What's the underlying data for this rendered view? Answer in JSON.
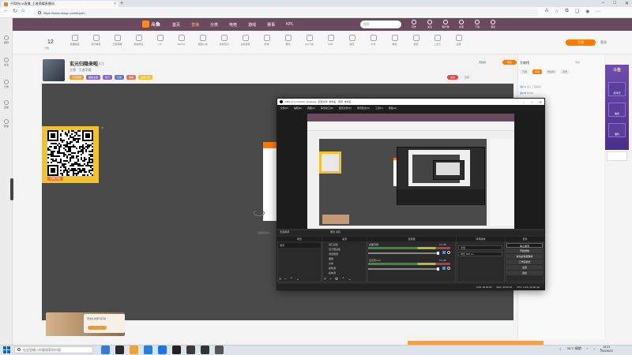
{
  "browser": {
    "tab_title": "不知所CA直播_王者荣耀直播间",
    "url": "https://www.douyu.com/topic/..."
  },
  "site": {
    "logo": "斗鱼",
    "nav": [
      "首页",
      "直播",
      "分类",
      "电竞",
      "游戏",
      "赛事",
      "KPL"
    ],
    "search_placeholder": "搜索",
    "header_icons": [
      "历史",
      "关注",
      "客户端",
      "充值",
      "下载",
      "消息"
    ],
    "category_count": "12",
    "category_count_label": "分类",
    "categories": [
      "英雄联盟",
      "和平精英",
      "王者荣耀",
      "绝地求生",
      "CS",
      "DOTA2",
      "穿越火线",
      "永劫无间",
      "主机游戏",
      "原神",
      "星际",
      "QQ飞车",
      "DNF",
      "魔兽",
      "户外",
      "单机",
      "颜值",
      "二次元",
      "全部"
    ],
    "open_live": "开播",
    "login": "登录"
  },
  "streamer": {
    "name": "玄元归隐来啦",
    "sub": "关注",
    "meta": "主播 · 王者荣耀",
    "tags": [
      {
        "label": "王者荣耀",
        "color": "#f19a2b"
      },
      {
        "label": "超级主播",
        "color": "#8b63d1"
      },
      {
        "label": "热门",
        "color": "#8b63d1"
      },
      {
        "label": "分享",
        "color": "#5f78c7"
      },
      {
        "label": "举报",
        "color": "#e8744f"
      },
      {
        "label": "主播公告",
        "color": "#f1c22b"
      }
    ],
    "actions": [
      {
        "label": "关注",
        "bg": "#e44",
        "fg": "#fff"
      },
      {
        "label": "分享",
        "bg": "#eee",
        "fg": "#666"
      }
    ],
    "rank": "贡献榜",
    "fans": "粉丝"
  },
  "video": {
    "qr_label": "扫码下载",
    "status": "直播加载中..."
  },
  "gift": {
    "text": "赠送礼物即可获得",
    "button": ""
  },
  "chat": {
    "title": "贡献榜",
    "rank": "周榜",
    "tabs": [
      "日榜",
      "周榜",
      "粉丝榜",
      "贵宾"
    ],
    "lines": [
      {
        "user": "用户A",
        "msg": "进入了直播间"
      },
      {
        "user": "用户B",
        "msg": "66666"
      },
      {
        "user": "用户C",
        "msg": "主播好强"
      },
      {
        "user": "用户D",
        "msg": "进入了直播间"
      },
      {
        "user": "用户E",
        "msg": "来了来了"
      },
      {
        "user": "用户F",
        "msg": "进入了直播间"
      },
      {
        "user": "用户G",
        "msg": "送出了礼物"
      },
      {
        "user": "用户H",
        "msg": "进入了直播间"
      },
      {
        "user": "用户I",
        "msg": "关注了主播"
      },
      {
        "user": "用户J",
        "msg": "进入了直播间"
      },
      {
        "user": "用户K",
        "msg": "哈哈哈"
      },
      {
        "user": "用户L",
        "msg": "进入了直播间"
      },
      {
        "user": "用户M",
        "msg": "进入了直播间"
      },
      {
        "user": "用户N",
        "msg": "送出了礼物"
      },
      {
        "user": "用户O",
        "msg": "进入了直播间"
      },
      {
        "user": "用户P",
        "msg": "进入了直播间"
      },
      {
        "user": "用户Q",
        "msg": "进入了直播间"
      },
      {
        "user": "用户R",
        "msg": "进入了直播间"
      },
      {
        "user": "用户S",
        "msg": "666"
      },
      {
        "user": "用户T",
        "msg": "进入了直播间"
      },
      {
        "user": "用户U",
        "msg": "进入了直播间"
      },
      {
        "user": "用户V",
        "msg": "进入了直播间"
      },
      {
        "user": "用户W",
        "msg": "进入了直播间"
      },
      {
        "user": "用户X",
        "msg": "进入了直播间"
      },
      {
        "user": "用户Y",
        "msg": "进入了直播间"
      },
      {
        "user": "用户Z",
        "msg": "进入了直播间"
      },
      {
        "user": "用户AA",
        "msg": "进入了直播间"
      },
      {
        "user": "用户AB",
        "msg": "进入了直播间"
      },
      {
        "user": "用户AC",
        "msg": "进入了直播间"
      },
      {
        "user": "用户AD",
        "msg": "进入了直播间"
      }
    ]
  },
  "promo": {
    "title": "斗鱼",
    "items": [
      "周年庆",
      "抽奖",
      "福利"
    ]
  },
  "left_sidebar": [
    "推荐",
    "关注",
    "分类",
    "直播",
    "赛事"
  ],
  "obs": {
    "title": "OBS 27.2.4 (64-bit, windows) - 配置文件: 未命名 - 场景: 未命名",
    "menu": [
      "文件(F)",
      "编辑(E)",
      "视图(V)",
      "停靠窗口(D)",
      "配置文件(P)",
      "场景集合(S)",
      "工具(T)",
      "帮助(H)"
    ],
    "scene_bar_label": "无选择源",
    "scene_bar_mid": "属性  滤镜",
    "docks": [
      "场景",
      "来源",
      "混音器",
      "转场特效",
      "控件"
    ],
    "scene_item": "场景",
    "sources": [
      "窗口采集",
      "显示器采集",
      "浏览器源",
      "图像",
      "文本",
      "颜色源",
      "媒体源"
    ],
    "mixer": [
      {
        "label": "桌面音频",
        "db": "0.0 dB"
      },
      {
        "label": "麦克风/Aux",
        "db": "0.0 dB"
      }
    ],
    "transition": "淡出",
    "duration": "时长  300 ms",
    "controls": [
      "停止推流",
      "开始录制",
      "启动虚拟摄像机",
      "工作室模式",
      "设置",
      "退出"
    ],
    "status": [
      "LIVE: 00:00:00",
      "REC: 00:00:00",
      "CPU: 2.4%, 60.00 fps"
    ]
  },
  "taskbar": {
    "search": "在这里输入你要搜索的内容",
    "apps": [
      "#3a7bd5",
      "#2a2a2a",
      "#e8a33a",
      "#2b7de1",
      "#1a73e8",
      "#222",
      "#3a3a3a",
      "#333",
      "#555"
    ],
    "weather": "35°C 晴朗",
    "time": "16:31",
    "date": "2022/8/29"
  }
}
